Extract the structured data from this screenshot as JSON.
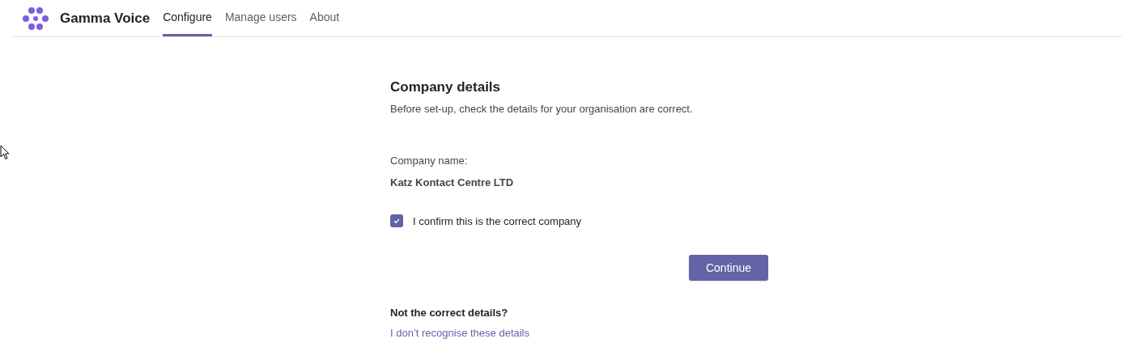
{
  "app": {
    "title": "Gamma Voice"
  },
  "tabs": [
    {
      "label": "Configure",
      "selected": true
    },
    {
      "label": "Manage users",
      "selected": false
    },
    {
      "label": "About",
      "selected": false
    }
  ],
  "form": {
    "heading": "Company details",
    "description": "Before set-up, check the details for your organisation are correct.",
    "field_label": "Company name:",
    "field_value": "Katz Kontact Centre LTD",
    "confirm": {
      "label": "I confirm this is the correct company",
      "checked": true
    },
    "button": "Continue"
  },
  "help": {
    "heading": "Not the correct details?",
    "link": "I don’t recognise these details"
  }
}
